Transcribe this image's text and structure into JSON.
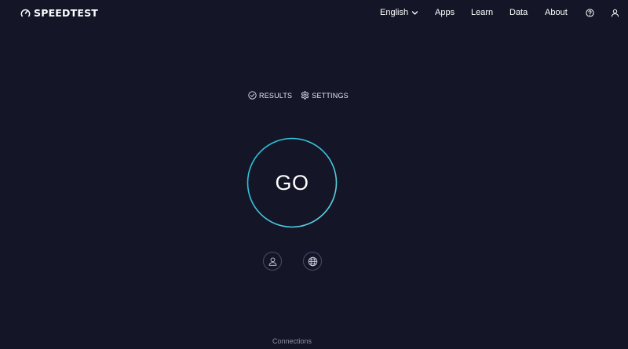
{
  "header": {
    "logo_text": "SPEEDTEST",
    "nav": {
      "language": "English",
      "apps": "Apps",
      "learn": "Learn",
      "data": "Data",
      "about": "About"
    },
    "icons": {
      "help": "help-icon",
      "account": "user-icon"
    }
  },
  "subnav": {
    "results_label": "RESULTS",
    "settings_label": "SETTINGS"
  },
  "go_button": {
    "label": "GO"
  },
  "connection_options": {
    "single_icon": "user-icon",
    "multi_icon": "globe-icon",
    "label": "Connections"
  },
  "colors": {
    "background": "#141628",
    "ring_start": "#1fc4da",
    "ring_end": "#6ad8e6",
    "text": "#ffffff",
    "muted": "#8d90a6"
  }
}
